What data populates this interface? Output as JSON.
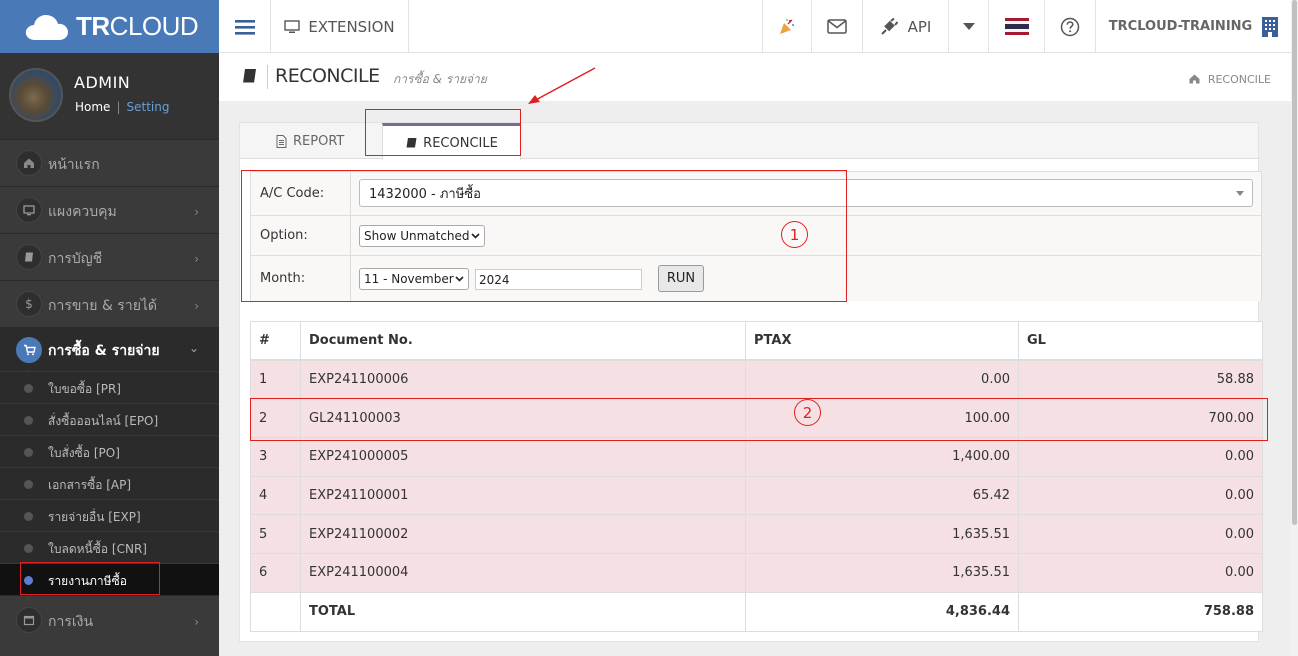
{
  "brand": {
    "logo_bold": "TR",
    "logo_rest": "CLOUD"
  },
  "profile": {
    "name": "ADMIN",
    "home": "Home",
    "sep": "|",
    "setting": "Setting"
  },
  "sidebar": {
    "items": [
      {
        "label": "หน้าแรก",
        "icon": "home-icon"
      },
      {
        "label": "แผงควบคุม",
        "icon": "monitor-icon"
      },
      {
        "label": "การบัญชี",
        "icon": "book-icon"
      },
      {
        "label": "การขาย & รายได้",
        "icon": "dollar-icon"
      },
      {
        "label": "การซื้อ & รายจ่าย",
        "icon": "cart-icon"
      },
      {
        "label": "การเงิน",
        "icon": "calendar-icon"
      }
    ],
    "subitems": [
      "ใบขอซื้อ [PR]",
      "สั่งซื้อออนไลน์ [EPO]",
      "ใบสั่งซื้อ [PO]",
      "เอกสารซื้อ [AP]",
      "รายจ่ายอื่น [EXP]",
      "ใบลดหนี้ซื้อ [CNR]",
      "รายงานภาษีซื้อ"
    ]
  },
  "topbar": {
    "extension": "EXTENSION",
    "api": "API",
    "company": "TRCLOUD-TRAINING"
  },
  "page": {
    "title": "RECONCILE",
    "subtitle": "การซื้อ & รายจ่าย",
    "breadcrumb": "RECONCILE"
  },
  "tabs": {
    "report": "REPORT",
    "reconcile": "RECONCILE"
  },
  "filters": {
    "ac_label": "A/C Code:",
    "ac_value": "1432000 - ภาษีซื้อ",
    "option_label": "Option:",
    "option_value": "Show Unmatched",
    "month_label": "Month:",
    "month_value": "11 - November",
    "year_value": "2024",
    "run": "RUN"
  },
  "table": {
    "headers": [
      "#",
      "Document No.",
      "PTAX",
      "GL"
    ],
    "rows": [
      {
        "n": "1",
        "doc": "EXP241100006",
        "ptax": "0.00",
        "gl": "58.88"
      },
      {
        "n": "2",
        "doc": "GL241100003",
        "ptax": "100.00",
        "gl": "700.00"
      },
      {
        "n": "3",
        "doc": "EXP241000005",
        "ptax": "1,400.00",
        "gl": "0.00"
      },
      {
        "n": "4",
        "doc": "EXP241100001",
        "ptax": "65.42",
        "gl": "0.00"
      },
      {
        "n": "5",
        "doc": "EXP241100002",
        "ptax": "1,635.51",
        "gl": "0.00"
      },
      {
        "n": "6",
        "doc": "EXP241100004",
        "ptax": "1,635.51",
        "gl": "0.00"
      }
    ],
    "total_label": "TOTAL",
    "total_ptax": "4,836.44",
    "total_gl": "758.88"
  },
  "annotations": {
    "one": "1",
    "two": "2"
  }
}
